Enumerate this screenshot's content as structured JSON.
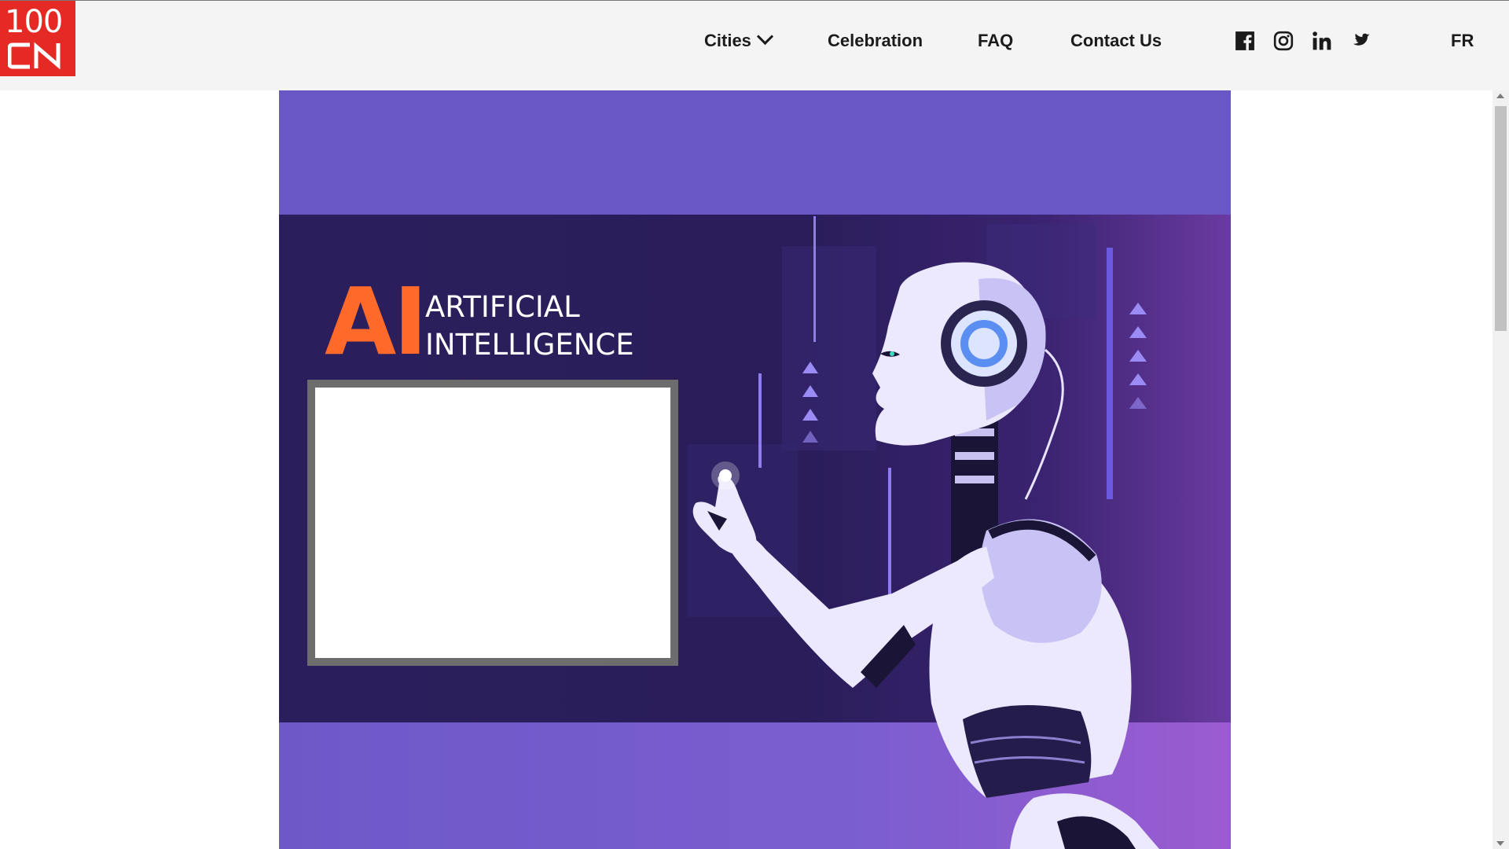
{
  "brand": {
    "logo_top": "100",
    "logo_bottom": "CN",
    "color": "#e52a25"
  },
  "nav": {
    "cities": "Cities",
    "celebration": "Celebration",
    "faq": "FAQ",
    "contact": "Contact Us",
    "lang": "FR"
  },
  "social": [
    "facebook-icon",
    "instagram-icon",
    "linkedin-icon",
    "twitter-icon"
  ],
  "hero": {
    "ai_big": "AI",
    "line1": "ARTIFICIAL",
    "line2": "INTELLIGENCE",
    "accent": "#ff6a2a",
    "background": "#6a57c6"
  }
}
